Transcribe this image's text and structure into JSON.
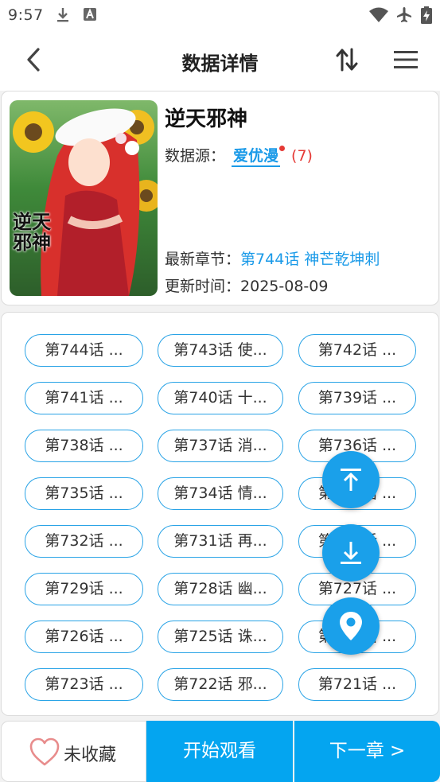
{
  "status_bar": {
    "time": "9:57"
  },
  "header": {
    "title": "数据详情"
  },
  "comic": {
    "title": "逆天邪神",
    "source_label": "数据源：",
    "source_name": "爱优漫",
    "source_count": "(7)",
    "latest_label": "最新章节：",
    "latest_value": "第744话 神芒乾坤刺",
    "update_label": "更新时间：",
    "update_value": "2025-08-09",
    "cover_text": "逆天邪神"
  },
  "chapters": [
    "第744话 ...",
    "第743话 使...",
    "第742话 ...",
    "第741话 ...",
    "第740话 十...",
    "第739话 ...",
    "第738话 ...",
    "第737话 消...",
    "第736话 ...",
    "第735话 ...",
    "第734话 情...",
    "第733话 ...",
    "第732话 ...",
    "第731话 再...",
    "第730话 ...",
    "第729话 ...",
    "第728话 幽...",
    "第727话 ...",
    "第726话 ...",
    "第725话 诛...",
    "第724话 ...",
    "第723话 ...",
    "第722话 邪...",
    "第721话 ..."
  ],
  "bottom": {
    "favorite_label": "未收藏",
    "start_label": "开始观看",
    "next_label": "下一章 >"
  },
  "colors": {
    "accent": "#04a5f0",
    "link": "#1a9ae8",
    "alert": "#e53935"
  }
}
